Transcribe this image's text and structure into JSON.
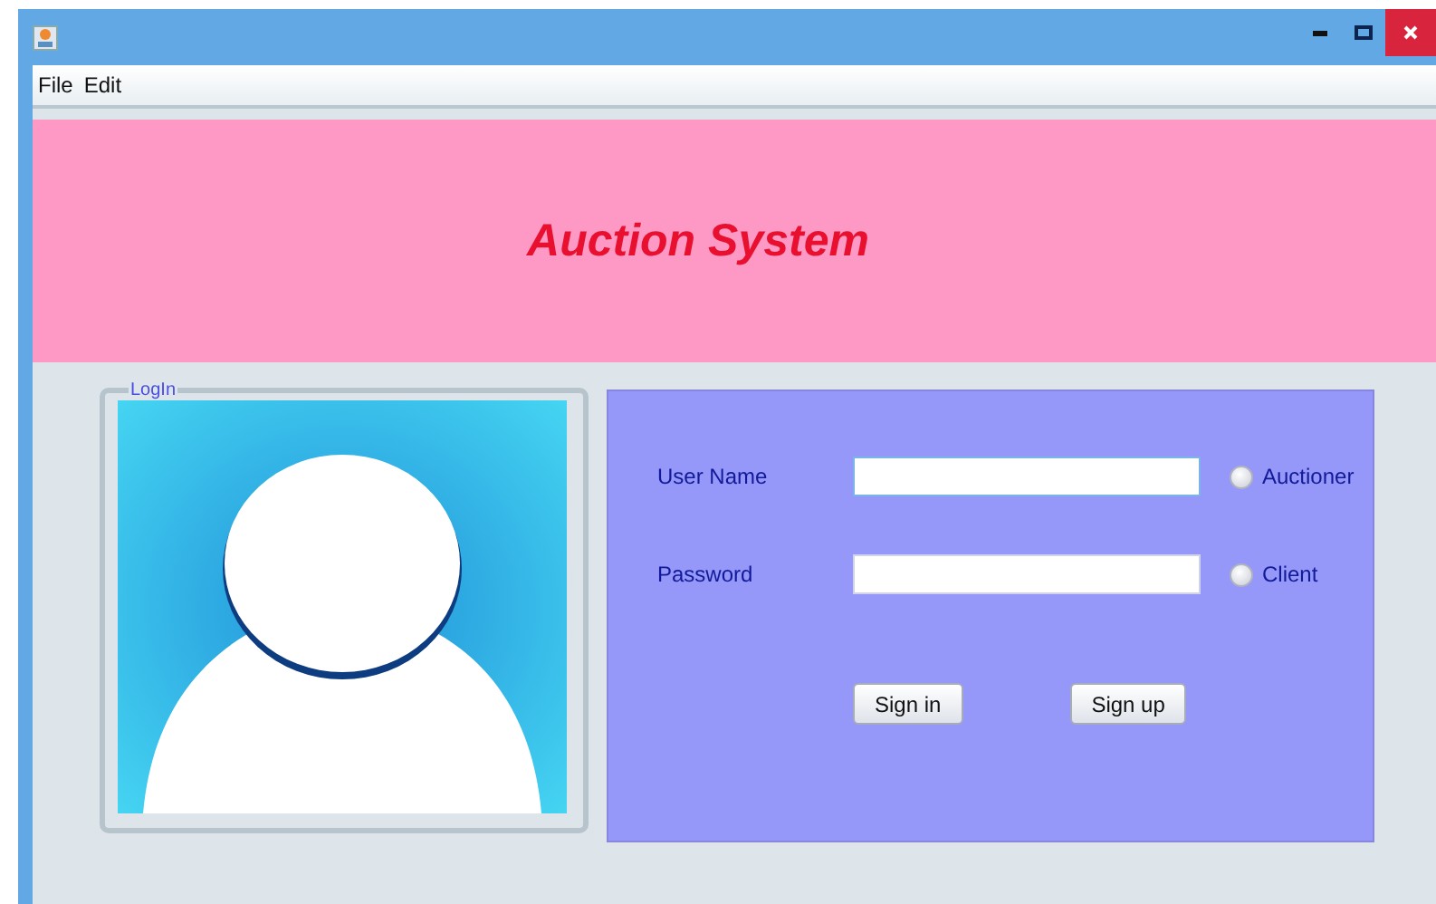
{
  "window": {
    "controls": [
      {
        "kind": "minimize"
      },
      {
        "kind": "maximize"
      },
      {
        "kind": "close"
      }
    ]
  },
  "menu": [
    "File",
    "Edit"
  ],
  "banner": {
    "title": "Auction System"
  },
  "login_panel": {
    "title": "LogIn"
  },
  "form": {
    "fields": [
      {
        "label": "User Name",
        "focused": true
      },
      {
        "label": "Password",
        "focused": false
      }
    ],
    "roles": [
      {
        "label": "Auctioner",
        "selected": false
      },
      {
        "label": "Client",
        "selected": false
      }
    ],
    "buttons": [
      "Sign in",
      "Sign up"
    ]
  }
}
